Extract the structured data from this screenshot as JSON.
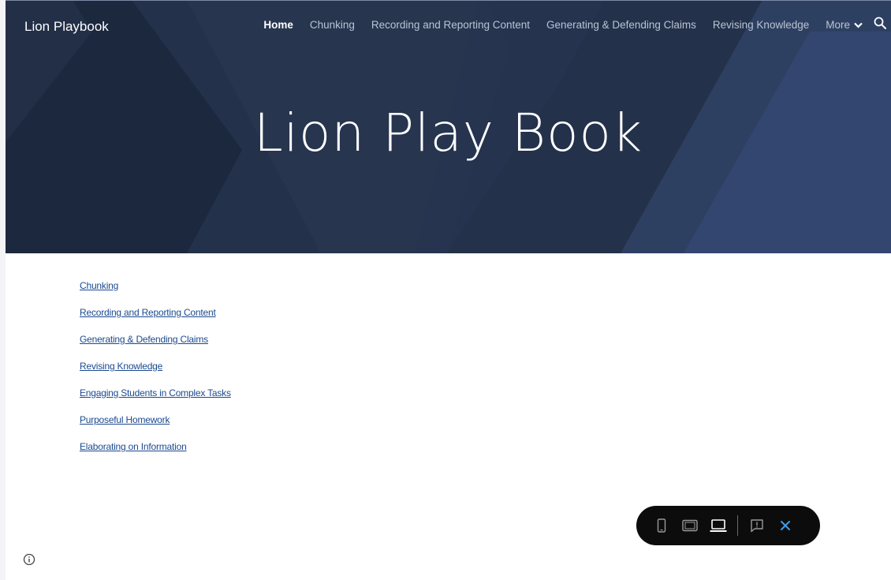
{
  "site": {
    "title": "Lion Playbook"
  },
  "nav": {
    "items": [
      {
        "label": "Home",
        "active": true
      },
      {
        "label": "Chunking"
      },
      {
        "label": "Recording and Reporting Content"
      },
      {
        "label": "Generating & Defending Claims"
      },
      {
        "label": "Revising Knowledge"
      }
    ],
    "more_label": "More",
    "icons": {
      "more": "chevron-down-icon",
      "search": "search-icon"
    }
  },
  "hero": {
    "title": "Lion Play Book"
  },
  "content": {
    "links": [
      {
        "label": "Chunking"
      },
      {
        "label": "Recording and Reporting Content"
      },
      {
        "label": "Generating & Defending Claims"
      },
      {
        "label": "Revising Knowledge"
      },
      {
        "label": "Engaging Students in Complex Tasks"
      },
      {
        "label": "Purposeful Homework"
      },
      {
        "label": "Elaborating on Information"
      }
    ]
  },
  "footer": {
    "icon": "info-icon"
  },
  "preview_bar": {
    "buttons": [
      "phone-preview-icon",
      "tablet-preview-icon",
      "laptop-preview-icon",
      "report-issue-icon",
      "close-icon"
    ],
    "active": "laptop-preview-icon"
  },
  "colors": {
    "hero_bg": "#24314a",
    "link": "#1b4a8f",
    "nav_inactive": "#b9c3d4",
    "accent_close": "#3b9cf0"
  }
}
